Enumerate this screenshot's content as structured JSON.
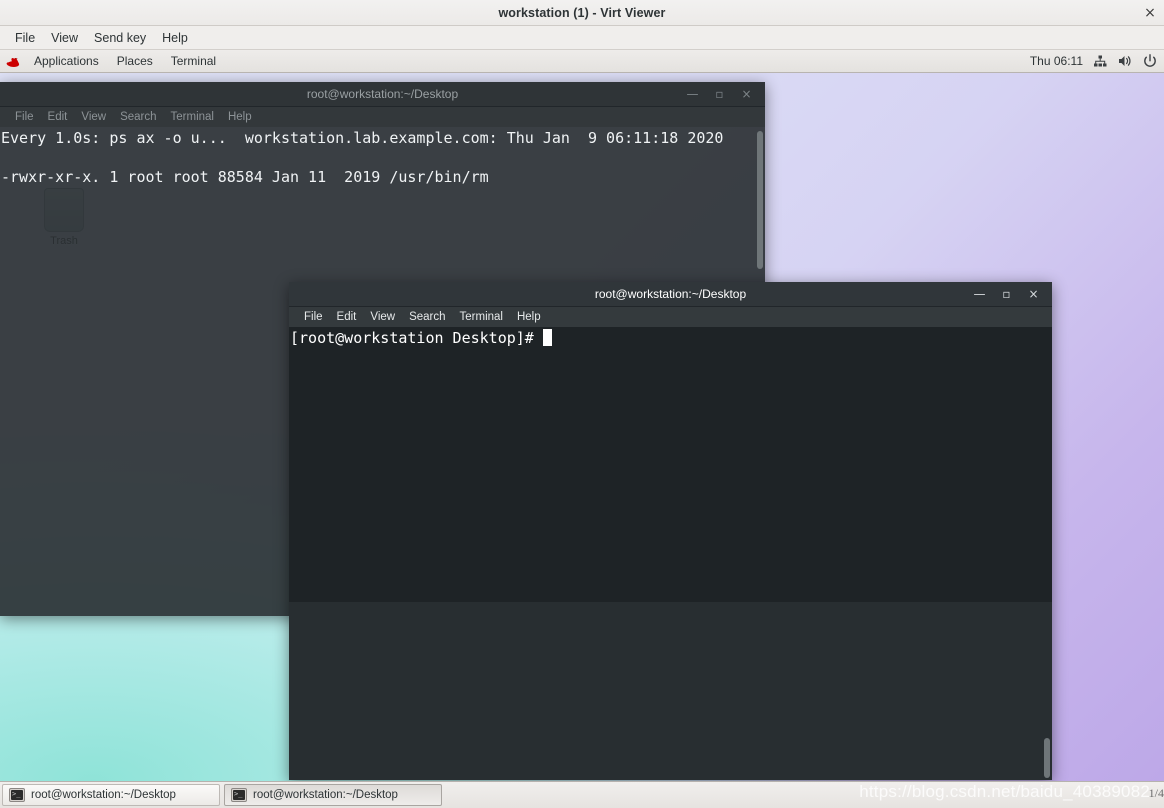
{
  "virt_viewer": {
    "title": "workstation (1) - Virt Viewer",
    "close_glyph": "×",
    "menu": [
      {
        "label": "File"
      },
      {
        "label": "View"
      },
      {
        "label": "Send key"
      },
      {
        "label": "Help"
      }
    ]
  },
  "gnome_panel": {
    "left_items": [
      {
        "label": "Applications",
        "icon": "redhat-logo-icon"
      },
      {
        "label": "Places",
        "icon": null
      },
      {
        "label": "Terminal",
        "icon": null
      }
    ],
    "clock": "Thu 06:11",
    "tray": [
      {
        "icon": "network-icon"
      },
      {
        "icon": "volume-icon"
      },
      {
        "icon": "power-icon"
      }
    ]
  },
  "desktop": {
    "icons": [
      {
        "name": "trash-icon",
        "label": "Trash"
      }
    ],
    "wallpaper_colors": {
      "top_left": "#dfe2f6",
      "bottom_right": "#bda8e8",
      "bottom_left_accent": "#8fe3d8"
    }
  },
  "terminal_windows": [
    {
      "id": "term1",
      "title": "root@workstation:~/Desktop",
      "focused": false,
      "menu": [
        "File",
        "Edit",
        "View",
        "Search",
        "Terminal",
        "Help"
      ],
      "buttons": {
        "minimize": "—",
        "maximize": "▫",
        "close": "×"
      },
      "content_lines": [
        "Every 1.0s: ps ax -o u...  workstation.lab.example.com: Thu Jan  9 06:11:18 2020",
        "",
        "-rwxr-xr-x. 1 root root 88584 Jan 11  2019 /usr/bin/rm"
      ]
    },
    {
      "id": "term2",
      "title": "root@workstation:~/Desktop",
      "focused": true,
      "menu": [
        "File",
        "Edit",
        "View",
        "Search",
        "Terminal",
        "Help"
      ],
      "buttons": {
        "minimize": "—",
        "maximize": "▫",
        "close": "×"
      },
      "content_lines": [
        "[root@workstation Desktop]# "
      ]
    }
  ],
  "taskbar": {
    "items": [
      {
        "label": "root@workstation:~/Desktop",
        "icon": "terminal-icon",
        "pressed": false
      },
      {
        "label": "root@workstation:~/Desktop",
        "icon": "terminal-icon",
        "pressed": true
      }
    ]
  },
  "watermark": {
    "text": "https://blog.csdn.net/baidu_40389082",
    "page_indicator": "1/4"
  }
}
